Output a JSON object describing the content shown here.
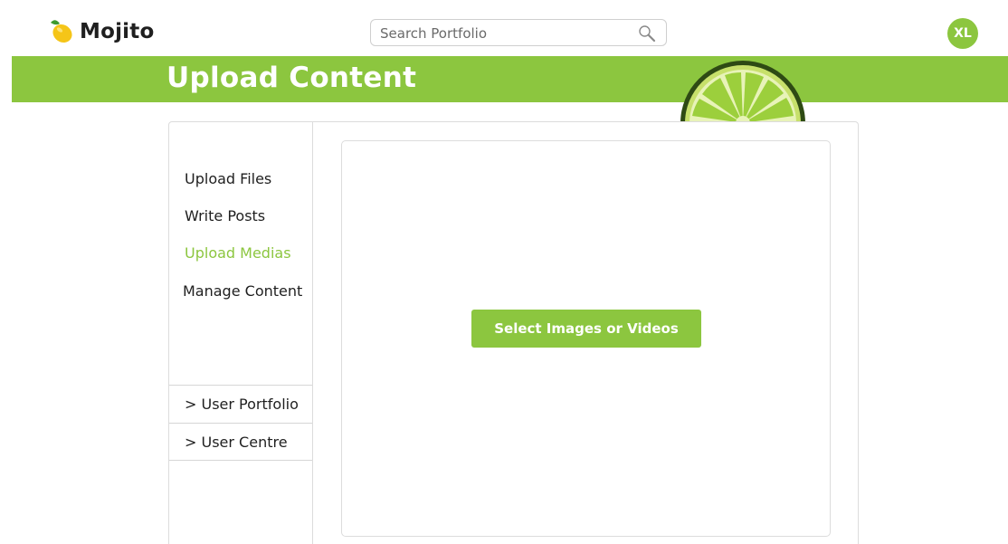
{
  "header": {
    "app_name": "Mojito",
    "logo_icon": "lemon-icon",
    "search": {
      "placeholder": "Search Portfolio",
      "value": "",
      "icon": "magnifier-icon"
    },
    "avatar_initials": "XL"
  },
  "banner": {
    "title": "Upload Content",
    "decoration_icon": "lime-slice-icon"
  },
  "sidebar": {
    "items": [
      {
        "label": "Upload Files",
        "active": false
      },
      {
        "label": "Write Posts",
        "active": false
      },
      {
        "label": "Upload Medias",
        "active": true
      },
      {
        "label": "Manage Content",
        "active": false
      }
    ],
    "links": [
      {
        "label": "> User Portfolio"
      },
      {
        "label": "> User Centre"
      }
    ]
  },
  "upload": {
    "button_label": "Select Images or Videos"
  },
  "colors": {
    "accent": "#8cc63f",
    "text": "#1f1f1f",
    "border": "#dcdcdc",
    "background": "#ffffff"
  }
}
